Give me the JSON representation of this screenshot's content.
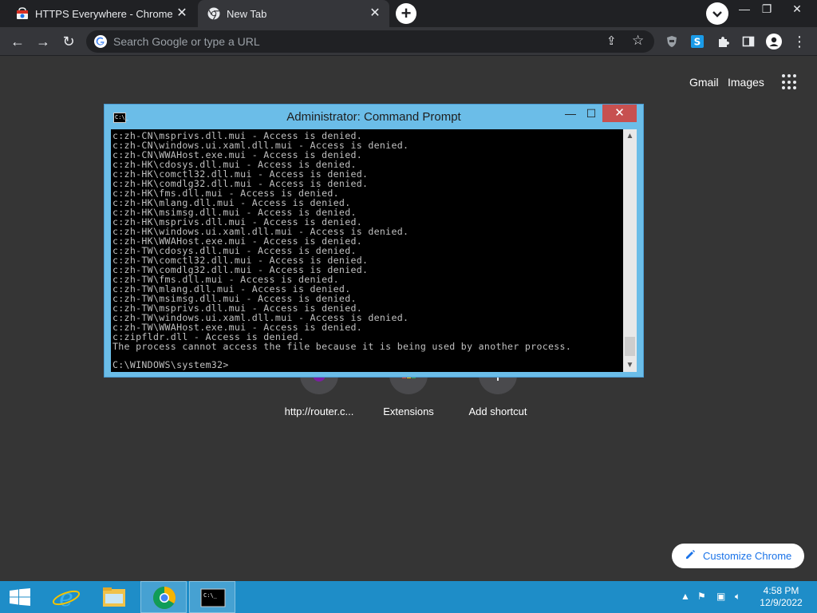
{
  "tabs": [
    {
      "title": "HTTPS Everywhere - Chrome Web Store",
      "active": false
    },
    {
      "title": "New Tab",
      "active": true
    }
  ],
  "omnibox": {
    "placeholder": "Search Google or type a URL"
  },
  "ntp": {
    "links": {
      "gmail": "Gmail",
      "images": "Images"
    },
    "shortcuts": [
      {
        "label": "http://router.c..."
      },
      {
        "label": "Extensions"
      },
      {
        "label": "Add shortcut"
      }
    ],
    "customize_label": "Customize Chrome"
  },
  "cmd": {
    "title": "Administrator: Command Prompt",
    "lines": [
      "c:zh-CN\\msprivs.dll.mui - Access is denied.",
      "c:zh-CN\\windows.ui.xaml.dll.mui - Access is denied.",
      "c:zh-CN\\WWAHost.exe.mui - Access is denied.",
      "c:zh-HK\\cdosys.dll.mui - Access is denied.",
      "c:zh-HK\\comctl32.dll.mui - Access is denied.",
      "c:zh-HK\\comdlg32.dll.mui - Access is denied.",
      "c:zh-HK\\fms.dll.mui - Access is denied.",
      "c:zh-HK\\mlang.dll.mui - Access is denied.",
      "c:zh-HK\\msimsg.dll.mui - Access is denied.",
      "c:zh-HK\\msprivs.dll.mui - Access is denied.",
      "c:zh-HK\\windows.ui.xaml.dll.mui - Access is denied.",
      "c:zh-HK\\WWAHost.exe.mui - Access is denied.",
      "c:zh-TW\\cdosys.dll.mui - Access is denied.",
      "c:zh-TW\\comctl32.dll.mui - Access is denied.",
      "c:zh-TW\\comdlg32.dll.mui - Access is denied.",
      "c:zh-TW\\fms.dll.mui - Access is denied.",
      "c:zh-TW\\mlang.dll.mui - Access is denied.",
      "c:zh-TW\\msimsg.dll.mui - Access is denied.",
      "c:zh-TW\\msprivs.dll.mui - Access is denied.",
      "c:zh-TW\\windows.ui.xaml.dll.mui - Access is denied.",
      "c:zh-TW\\WWAHost.exe.mui - Access is denied.",
      "c:zipfldr.dll - Access is denied.",
      "The process cannot access the file because it is being used by another process."
    ],
    "prompt": "C:\\WINDOWS\\system32>"
  },
  "taskbar": {
    "clock_time": "4:58 PM",
    "clock_date": "12/9/2022"
  },
  "colors": {
    "chrome_bg": "#353535",
    "taskbar": "#1e8dc8",
    "cmd_frame": "#6bbde8",
    "link_blue": "#1a73e8"
  }
}
